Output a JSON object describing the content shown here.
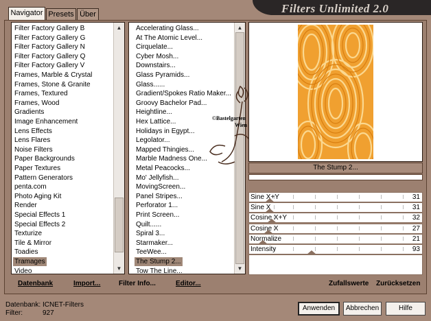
{
  "title": "Filters Unlimited 2.0",
  "tabs": [
    {
      "label": "Navigator"
    },
    {
      "label": "Presets"
    },
    {
      "label": "Über"
    }
  ],
  "categories": [
    "Filter Factory Gallery B",
    "Filter Factory Gallery G",
    "Filter Factory Gallery N",
    "Filter Factory Gallery Q",
    "Filter Factory Gallery V",
    "Frames, Marble & Crystal",
    "Frames, Stone & Granite",
    "Frames, Textured",
    "Frames, Wood",
    "Gradients",
    "Image Enhancement",
    "Lens Effects",
    "Lens Flares",
    "Noise Filters",
    "Paper Backgrounds",
    "Paper Textures",
    "Pattern Generators",
    "penta.com",
    "Photo Aging Kit",
    "Render",
    "Special Effects 1",
    "Special Effects 2",
    "Texturize",
    "Tile & Mirror",
    "Toadies",
    "Tramages",
    "Video"
  ],
  "selected_category": "Tramages",
  "filters": [
    "Accelerating Glass...",
    "At The Atomic Level...",
    "Cirquelate...",
    "Cyber Mosh...",
    "Downstairs...",
    "Glass Pyramids...",
    "Glass......",
    "Gradient/Spokes Ratio Maker...",
    "Groovy Bachelor Pad...",
    "Heightline...",
    "Hex Lattice...",
    "Holidays in Egypt...",
    "Legolator...",
    "Mapped Thingies...",
    "Marble Madness One...",
    "Metal Peacocks...",
    "Mo' Jellyfish...",
    "MovingScreen...",
    "Panel Stripes...",
    "Perforator 1...",
    "Print Screen...",
    "Quilt......",
    "Spiral 3...",
    "Starmaker...",
    "TeeWee...",
    "The Stump 2...",
    "Tow The Line..."
  ],
  "selected_filter": "The Stump 2...",
  "current_filter_name": "The Stump 2...",
  "watermark": {
    "line1": "©Bastelgarten",
    "line2": "Wien"
  },
  "sliders": [
    {
      "label": "Sine X+Y",
      "value": "31",
      "fraction": 0.12
    },
    {
      "label": "Sine X",
      "value": "31",
      "fraction": 0.12
    },
    {
      "label": "Cosine X+Y",
      "value": "32",
      "fraction": 0.13
    },
    {
      "label": "Cosine X",
      "value": "27",
      "fraction": 0.11
    },
    {
      "label": "Normalize",
      "value": "21",
      "fraction": 0.08
    },
    {
      "label": "Intensity",
      "value": "93",
      "fraction": 0.36
    }
  ],
  "bottom_links": {
    "datenbank": "Datenbank",
    "import": "Import...",
    "filter_info": "Filter Info...",
    "editor": "Editor...",
    "zufallswerte": "Zufallswerte",
    "zuruecksetzen": "Zurücksetzen"
  },
  "status": {
    "db_label": "Datenbank:",
    "db_value": "ICNET-Filters",
    "filter_label": "Filter:",
    "filter_value": "927"
  },
  "buttons": {
    "apply": "Anwenden",
    "cancel": "Abbrechen",
    "help": "Hilfe"
  },
  "colors": {
    "background": "#a48878",
    "selection": "#a08878",
    "preview_orange": "#f0a030"
  }
}
